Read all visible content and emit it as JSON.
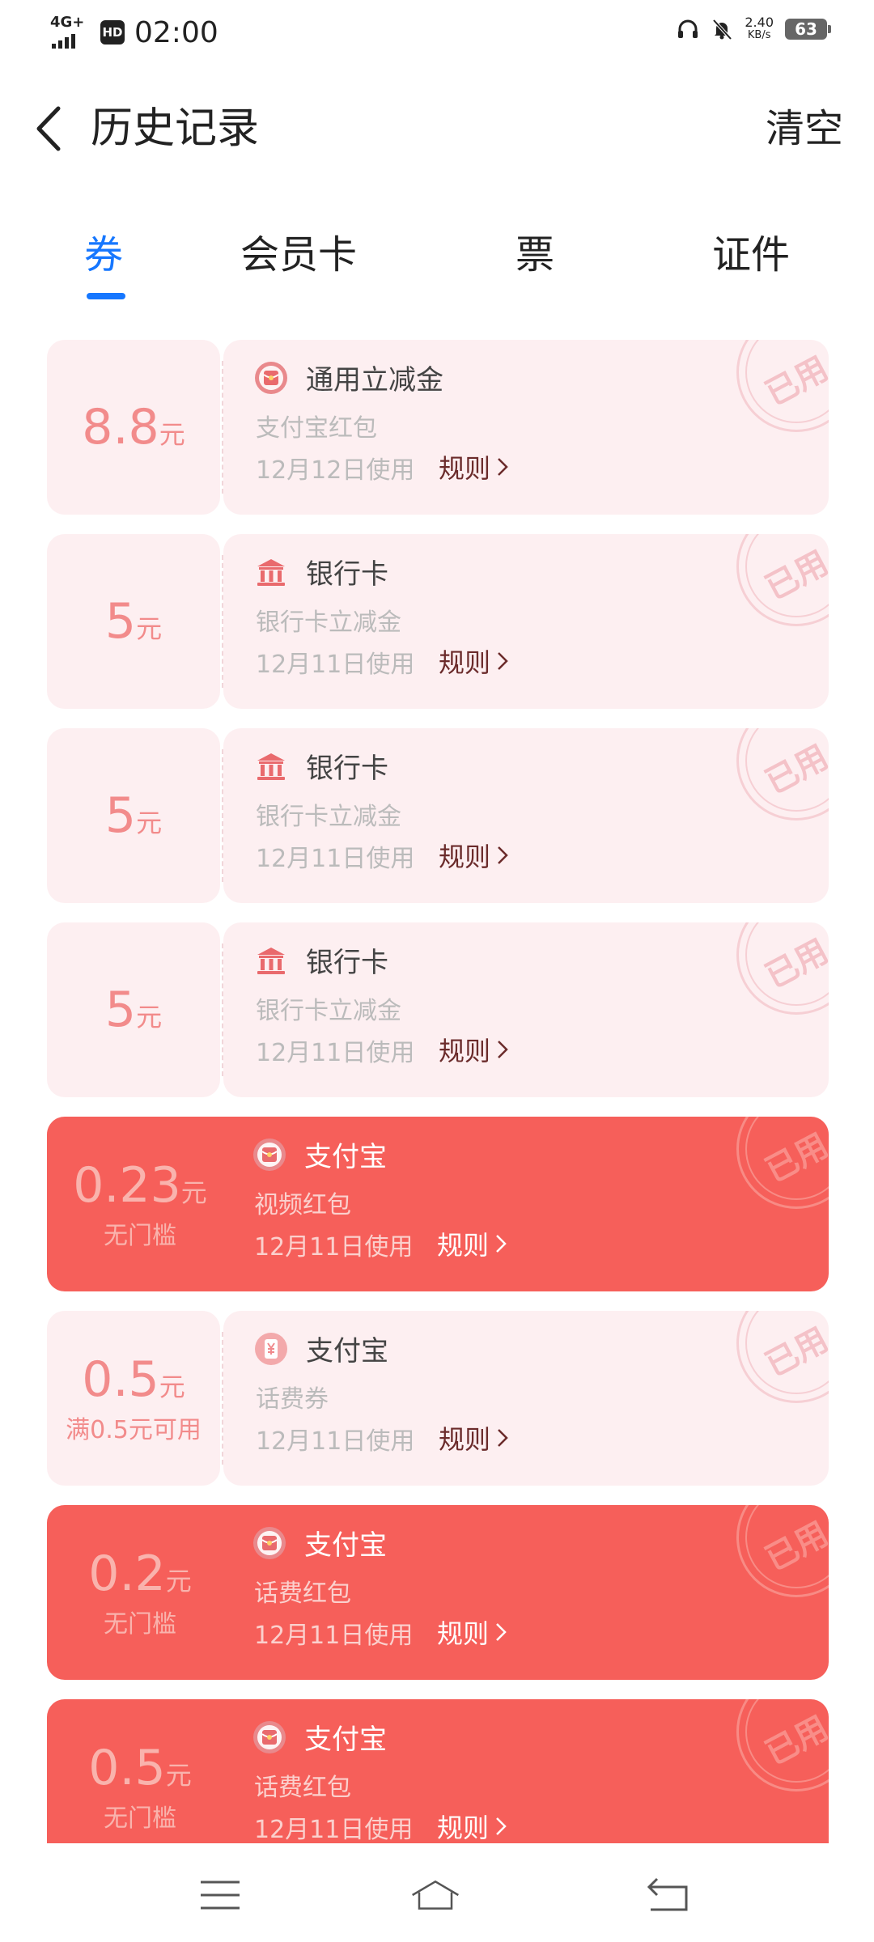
{
  "status_bar": {
    "network": "4G+",
    "hd": "HD",
    "time": "02:00",
    "speed_value": "2.40",
    "speed_unit": "KB/s",
    "battery": "63"
  },
  "header": {
    "title": "历史记录",
    "clear_label": "清空"
  },
  "tabs": [
    {
      "label": "券",
      "active": true
    },
    {
      "label": "会员卡",
      "active": false
    },
    {
      "label": "票",
      "active": false
    },
    {
      "label": "证件",
      "active": false
    }
  ],
  "coupons": [
    {
      "amount": "8.8",
      "unit": "元",
      "condition": "",
      "title": "通用立减金",
      "subtitle": "支付宝红包",
      "date": "12月12日使用",
      "rule": "规则",
      "icon": "red-packet-icon",
      "style": "pale",
      "stamp": "已用"
    },
    {
      "amount": "5",
      "unit": "元",
      "condition": "",
      "title": "银行卡",
      "subtitle": "银行卡立减金",
      "date": "12月11日使用",
      "rule": "规则",
      "icon": "bank-icon",
      "style": "pale",
      "stamp": "已用"
    },
    {
      "amount": "5",
      "unit": "元",
      "condition": "",
      "title": "银行卡",
      "subtitle": "银行卡立减金",
      "date": "12月11日使用",
      "rule": "规则",
      "icon": "bank-icon",
      "style": "pale",
      "stamp": "已用"
    },
    {
      "amount": "5",
      "unit": "元",
      "condition": "",
      "title": "银行卡",
      "subtitle": "银行卡立减金",
      "date": "12月11日使用",
      "rule": "规则",
      "icon": "bank-icon",
      "style": "pale",
      "stamp": "已用"
    },
    {
      "amount": "0.23",
      "unit": "元",
      "condition": "无门槛",
      "title": "支付宝",
      "subtitle": "视频红包",
      "date": "12月11日使用",
      "rule": "规则",
      "icon": "red-packet-icon",
      "style": "red",
      "stamp": "已用"
    },
    {
      "amount": "0.5",
      "unit": "元",
      "condition": "满0.5元可用",
      "title": "支付宝",
      "subtitle": "话费券",
      "date": "12月11日使用",
      "rule": "规则",
      "icon": "yen-coupon-icon",
      "style": "pale",
      "stamp": "已用"
    },
    {
      "amount": "0.2",
      "unit": "元",
      "condition": "无门槛",
      "title": "支付宝",
      "subtitle": "话费红包",
      "date": "12月11日使用",
      "rule": "规则",
      "icon": "red-packet-icon",
      "style": "red",
      "stamp": "已用"
    },
    {
      "amount": "0.5",
      "unit": "元",
      "condition": "无门槛",
      "title": "支付宝",
      "subtitle": "话费红包",
      "date": "12月11日使用",
      "rule": "规则",
      "icon": "red-packet-icon",
      "style": "red",
      "stamp": "已用"
    }
  ],
  "nav_bar": {
    "icons": [
      "menu-icon",
      "home-icon",
      "back-icon"
    ]
  },
  "colors": {
    "accent": "#1677ff",
    "coupon_pale_bg": "#fdeff1",
    "coupon_red_bg": "#f65f5a",
    "amount_pale": "#f28b8b"
  }
}
